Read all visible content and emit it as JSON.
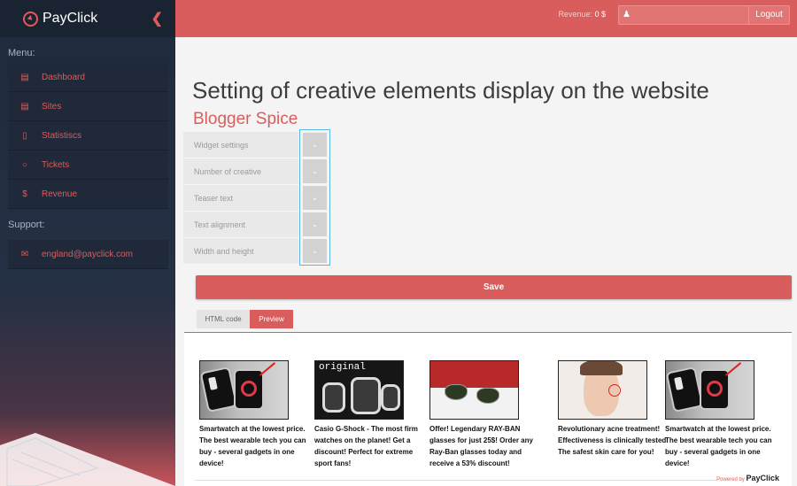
{
  "brand": {
    "name": "PayClick"
  },
  "sidebar": {
    "menu_heading": "Menu:",
    "items": [
      {
        "label": "Dashboard",
        "icon": "list-icon"
      },
      {
        "label": "Sites",
        "icon": "document-icon"
      },
      {
        "label": "Statistiscs",
        "icon": "bar-chart-icon"
      },
      {
        "label": "Tickets",
        "icon": "chat-icon"
      },
      {
        "label": "Revenue",
        "icon": "dollar-icon"
      }
    ],
    "support_heading": "Support:",
    "support_email": "england@payclick.com"
  },
  "topbar": {
    "revenue_label": "Revenue:",
    "revenue_value": "0 $",
    "logout": "Logout"
  },
  "main": {
    "title": "Setting of creative elements display on the website",
    "site_name": "Blogger Spice",
    "settings": [
      "Widget settings",
      "Number of creative",
      "Teaser text",
      "Text alignment",
      "Width and height"
    ],
    "save": "Save",
    "tabs": {
      "html": "HTML code",
      "preview": "Preview"
    }
  },
  "preview": {
    "cards": [
      {
        "text": "Smartwatch at the lowest price. The best wearable tech you can buy - several gadgets in one device!"
      },
      {
        "text": "Casio G-Shock - The most firm watches on the planet! Get a discount! Perfect for extreme sport fans!",
        "image_label": "original"
      },
      {
        "text": "Offer! Legendary RAY-BAN glasses for just 25$! Order any Ray-Ban glasses today and receive a 53% discount!"
      },
      {
        "text": "Revolutionary acne treatment! Effectiveness is clinically tested! The safest skin care for you!"
      },
      {
        "text": "Smartwatch at the lowest price. The best wearable tech you can buy - several gadgets in one device!"
      }
    ],
    "powered_by": "Powered by",
    "powered_brand": "PayClick"
  },
  "colors": {
    "accent": "#d95d5d",
    "sidebar": "#1f2a3c",
    "focus": "#5fb4e0"
  }
}
